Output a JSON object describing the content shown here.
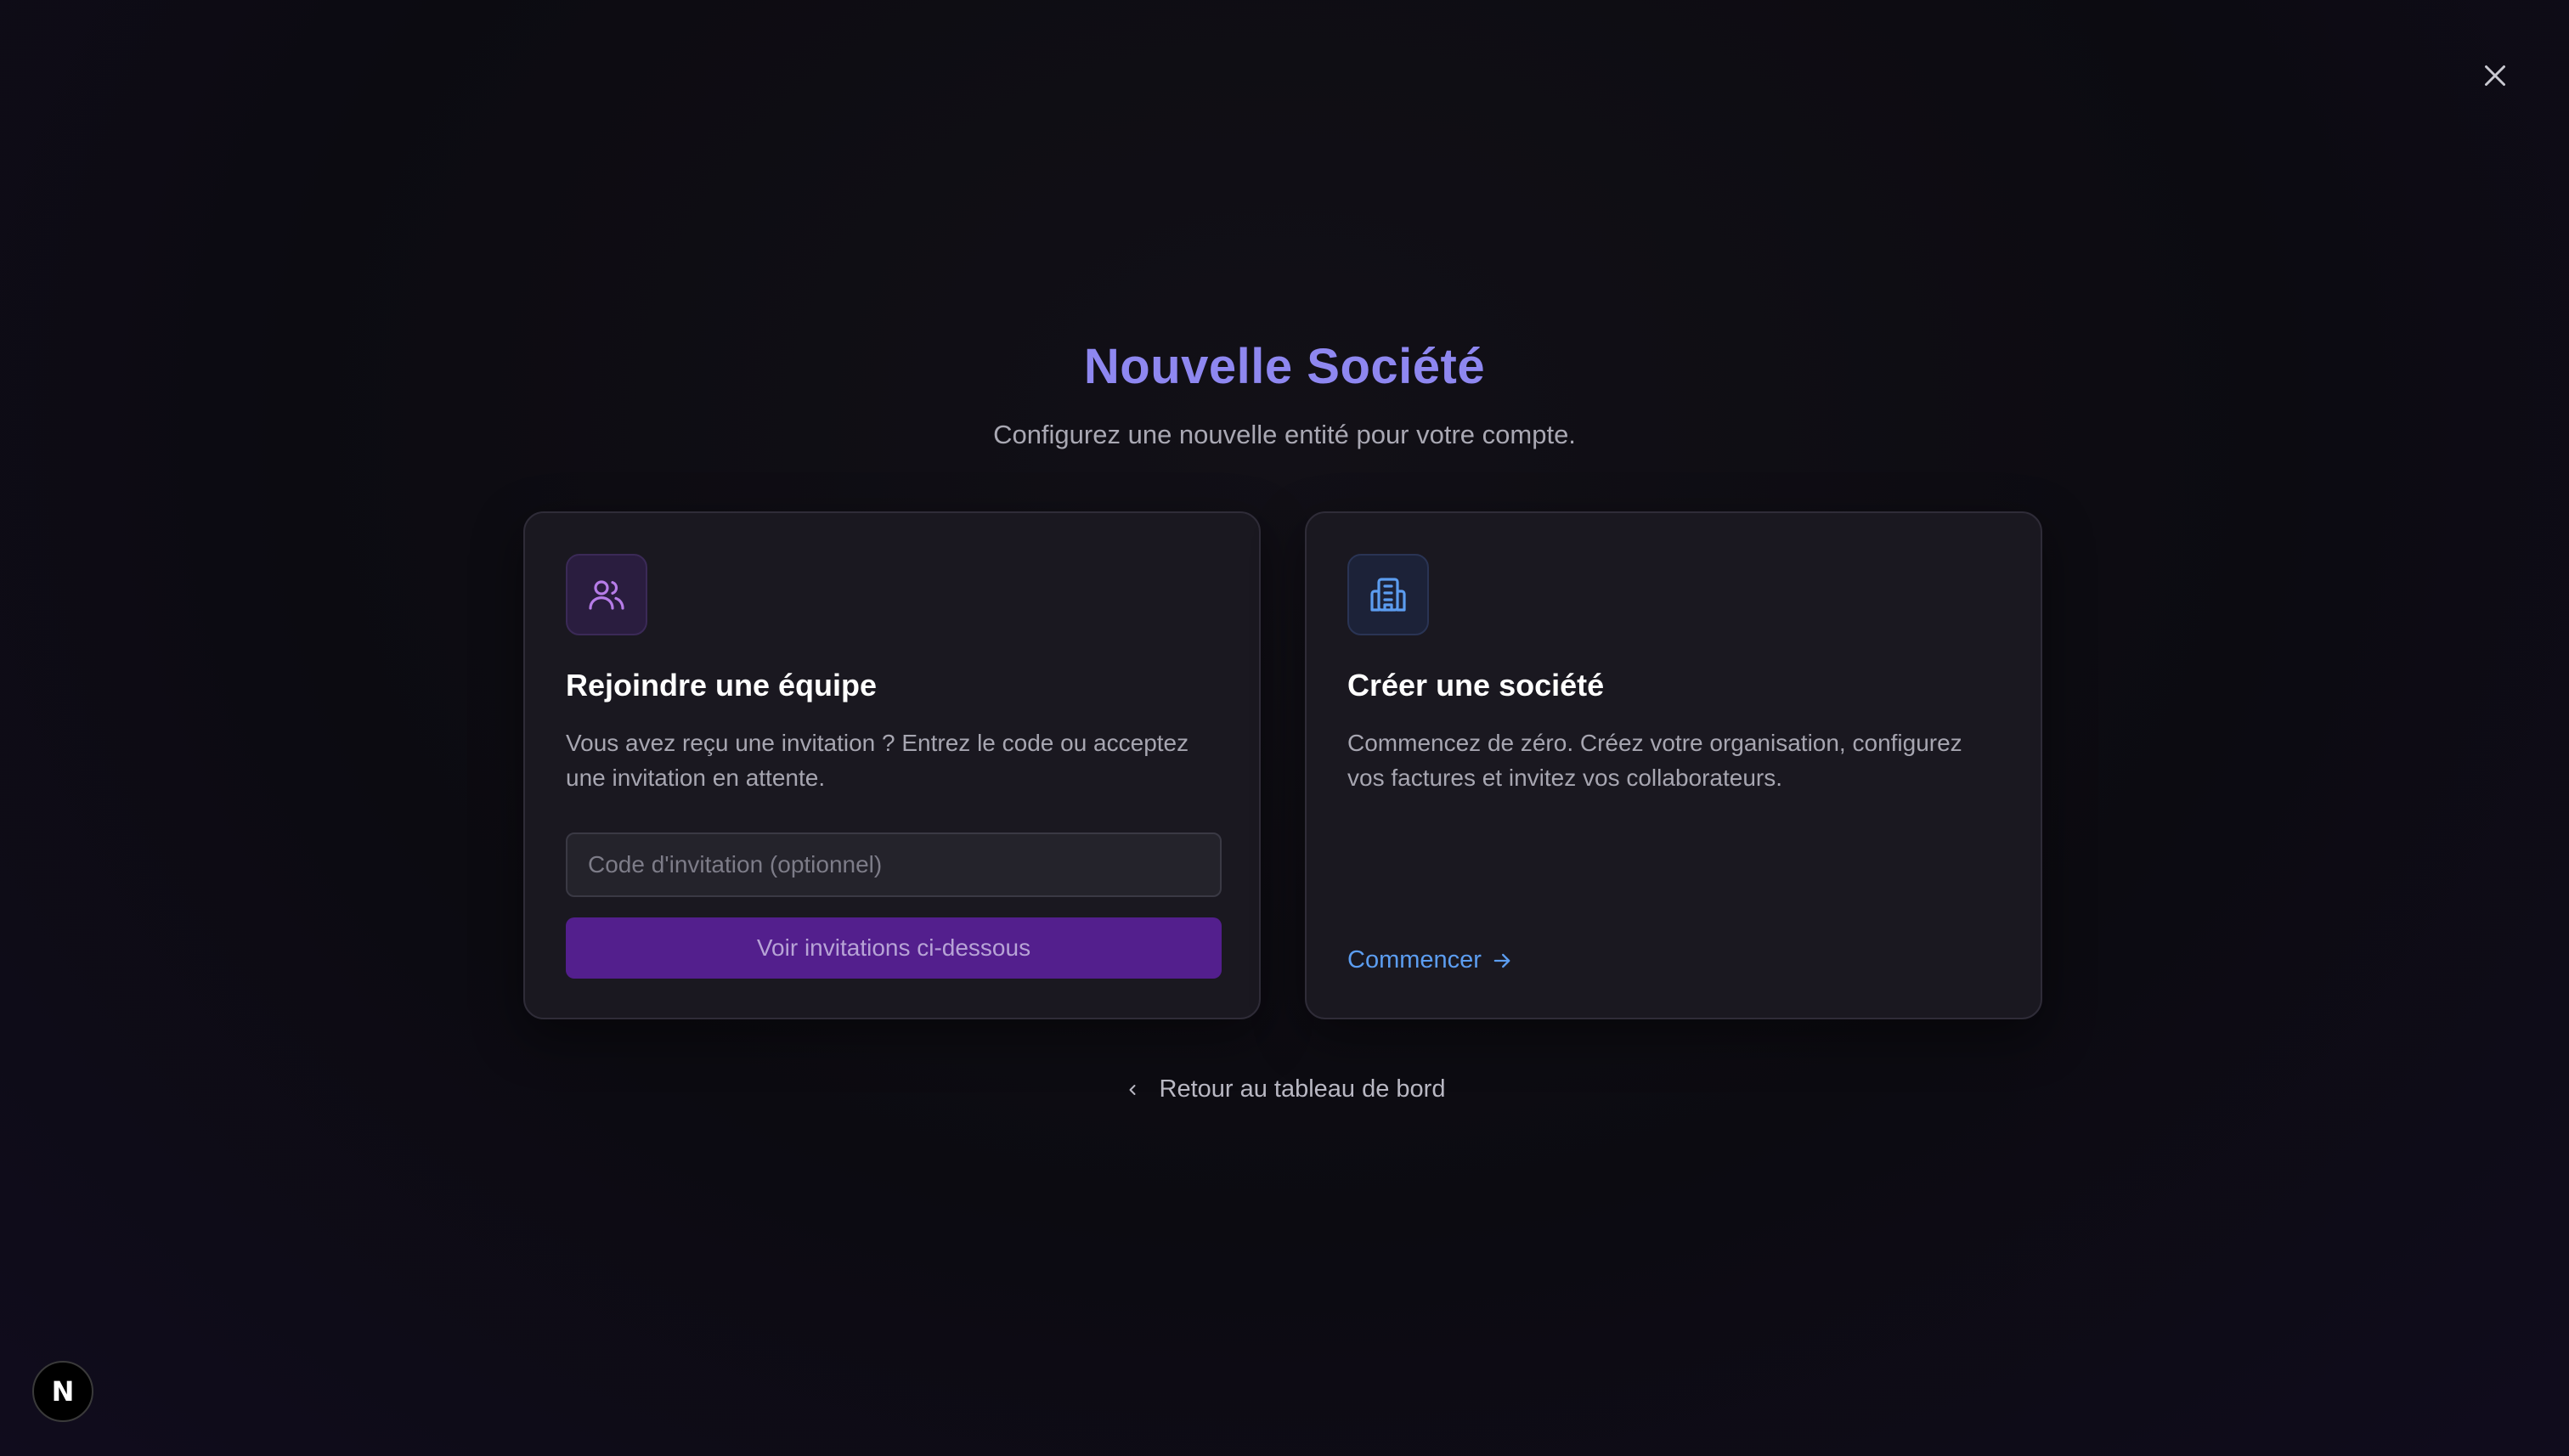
{
  "header": {
    "title": "Nouvelle Société",
    "subtitle": "Configurez une nouvelle entité pour votre compte."
  },
  "join_card": {
    "icon": "users-icon",
    "title": "Rejoindre une équipe",
    "description": "Vous avez reçu une invitation ? Entrez le code ou acceptez une invitation en attente.",
    "input_placeholder": "Code d'invitation (optionnel)",
    "input_value": "",
    "button_label": "Voir invitations ci-dessous"
  },
  "create_card": {
    "icon": "building-icon",
    "title": "Créer une société",
    "description": "Commencez de zéro. Créez votre organisation, configurez vos factures et invitez vos collaborateurs.",
    "link_label": "Commencer"
  },
  "back_link": {
    "label": "Retour au tableau de bord"
  },
  "badge": {
    "letter": "N"
  },
  "colors": {
    "accent_title": "#8e87f0",
    "button_purple": "#531f8d",
    "link_blue": "#5c9df0"
  }
}
